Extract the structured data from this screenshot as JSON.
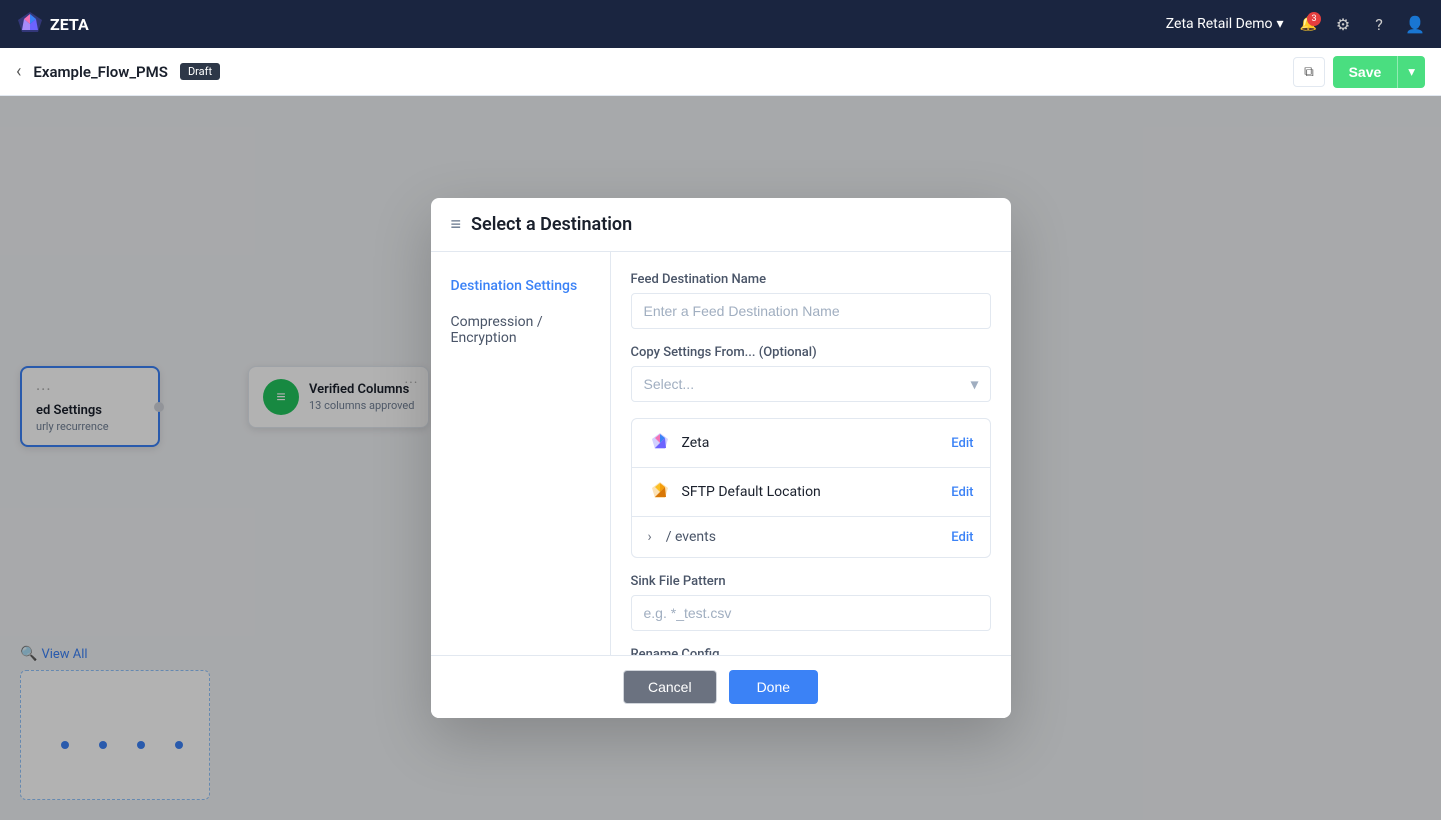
{
  "topNav": {
    "brand": "ZETA",
    "user": "Zeta Retail Demo",
    "notifCount": "3",
    "chevron": "▾"
  },
  "subNav": {
    "flowName": "Example_Flow_PMS",
    "draftLabel": "Draft",
    "saveLabel": "Save"
  },
  "canvas": {
    "node1": {
      "dots": "···",
      "title": "ed Settings",
      "subtitle": "urly recurrence"
    },
    "node2": {
      "dots": "···",
      "title": "Verified Columns",
      "subtitle": "13 columns approved"
    }
  },
  "viewAll": "View All",
  "modal": {
    "headerIcon": "≡",
    "title": "Select a Destination",
    "sidebar": {
      "items": [
        {
          "id": "destination-settings",
          "label": "Destination Settings",
          "active": true
        },
        {
          "id": "compression-encryption",
          "label": "Compression / Encryption",
          "active": false
        }
      ]
    },
    "content": {
      "feedNameLabel": "Feed Destination Name",
      "feedNamePlaceholder": "Enter a Feed Destination Name",
      "copySettingsLabel": "Copy Settings From... (Optional)",
      "copySettingsPlaceholder": "Select...",
      "destinations": [
        {
          "id": "zeta",
          "name": "Zeta",
          "editLabel": "Edit"
        },
        {
          "id": "sftp",
          "name": "SFTP Default Location",
          "editLabel": "Edit"
        },
        {
          "id": "events",
          "chevron": "›",
          "path": "/ events",
          "editLabel": "Edit"
        }
      ],
      "sinkFilePatternLabel": "Sink File Pattern",
      "sinkFilePatternPlaceholder": "e.g. *_test.csv",
      "renameConfigLabel": "Rename Config"
    },
    "footer": {
      "cancelLabel": "Cancel",
      "doneLabel": "Done"
    }
  }
}
